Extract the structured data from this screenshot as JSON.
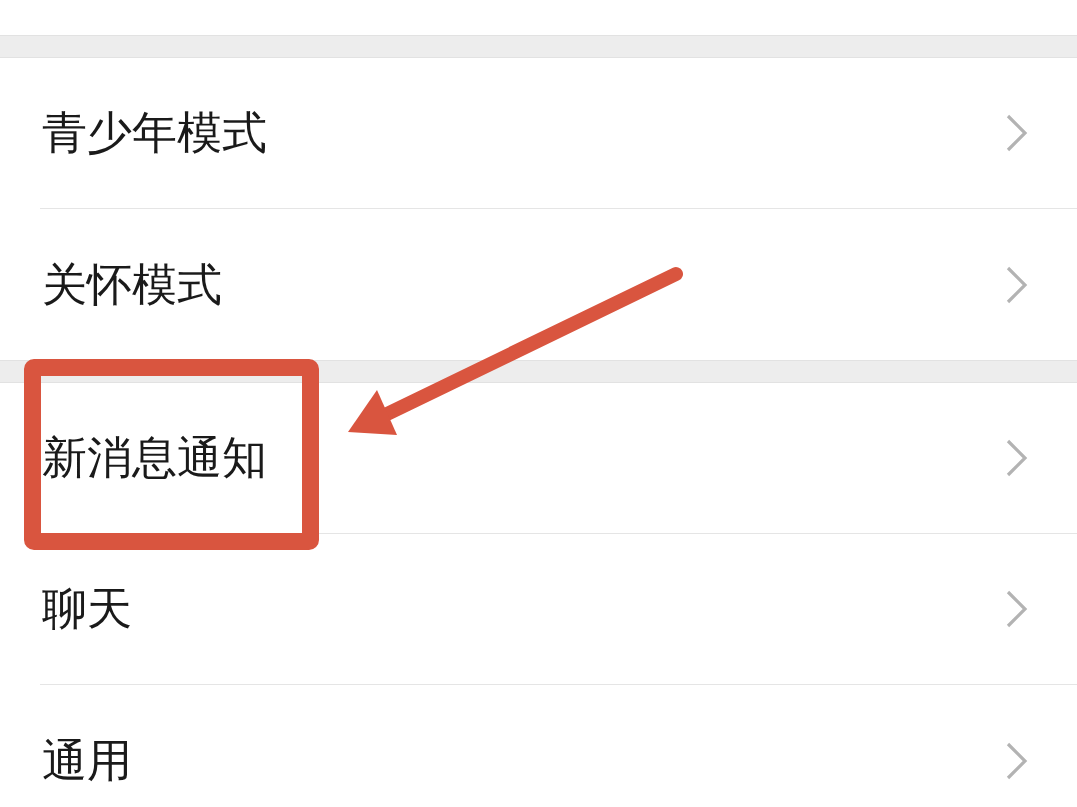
{
  "groups": [
    {
      "rows": [
        {
          "label": "青少年模式",
          "highlighted": false
        },
        {
          "label": "关怀模式",
          "highlighted": false
        }
      ]
    },
    {
      "rows": [
        {
          "label": "新消息通知",
          "highlighted": true
        },
        {
          "label": "聊天",
          "highlighted": false
        },
        {
          "label": "通用",
          "highlighted": false
        }
      ]
    }
  ]
}
